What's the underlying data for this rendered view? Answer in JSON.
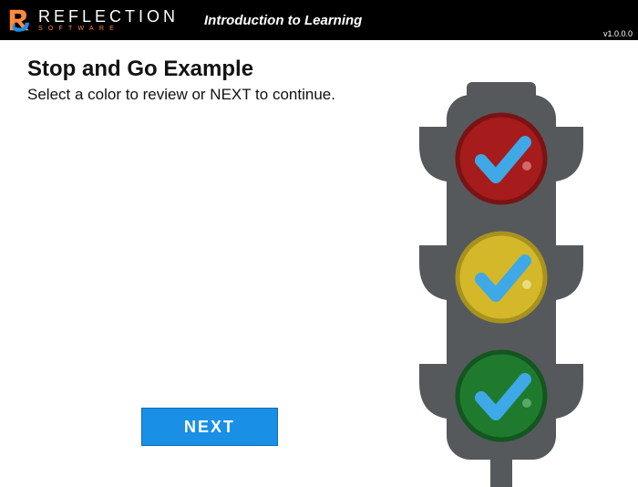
{
  "header": {
    "logo_main": "REFLECTION",
    "logo_sub": "SOFTWARE",
    "course_title": "Introduction to Learning",
    "version": "v1.0.0.0"
  },
  "page": {
    "title": "Stop and Go Example",
    "instruction": "Select a color to review or NEXT to continue."
  },
  "buttons": {
    "next": "NEXT"
  },
  "traffic_light": {
    "lights": [
      {
        "name": "red",
        "fill": "#a61b1b",
        "stroke": "#7a1313",
        "checked": true
      },
      {
        "name": "yellow",
        "fill": "#d4b82a",
        "stroke": "#a8921e",
        "checked": true
      },
      {
        "name": "green",
        "fill": "#1f7a2e",
        "stroke": "#145520",
        "checked": true
      }
    ],
    "check_color": "#3ea9e6"
  }
}
